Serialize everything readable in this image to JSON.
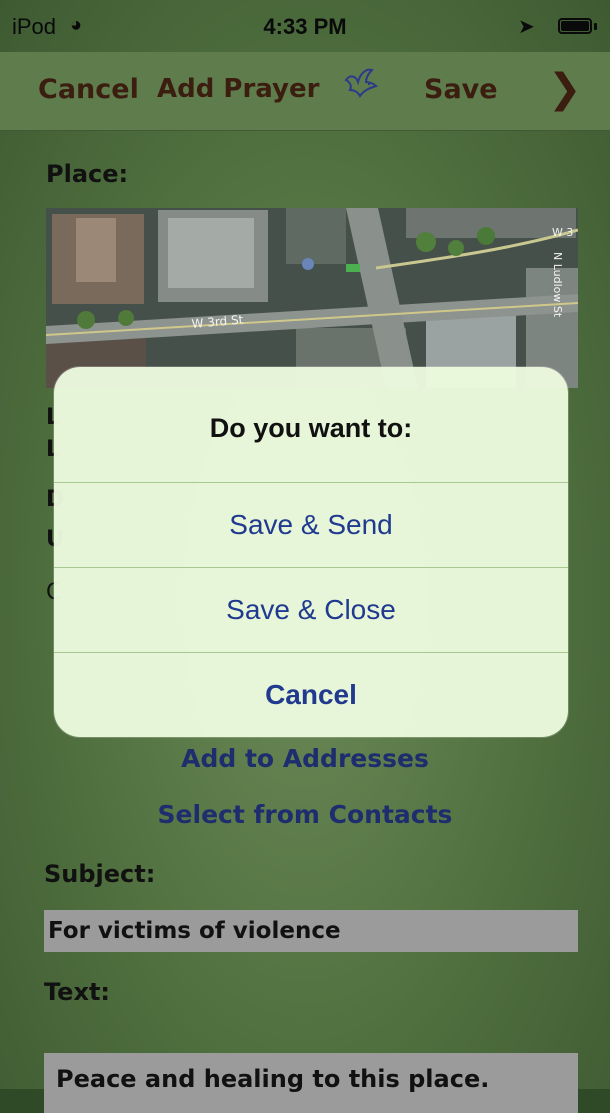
{
  "status_bar": {
    "carrier": "iPod",
    "time": "4:33 PM"
  },
  "nav_bar": {
    "cancel_label": "Cancel",
    "title": "Add Prayer",
    "save_label": "Save",
    "icons": [
      "dove-icon",
      "chevron-right-icon"
    ]
  },
  "form": {
    "place_label": "Place:",
    "map_street_labels": [
      "W 3rd St",
      "N Ludlow St",
      "W 3"
    ],
    "add_to_addresses": "Add to Addresses",
    "select_from_contacts": "Select from Contacts",
    "subject_label": "Subject:",
    "subject_value": "For victims of violence",
    "text_label": "Text:",
    "text_value": "Peace and healing to this place."
  },
  "alert": {
    "title": "Do you want to:",
    "actions": [
      "Save & Send",
      "Save & Close",
      "Cancel"
    ]
  },
  "colors": {
    "nav_text": "#3b1e10",
    "link_text": "#1d2d6e",
    "alert_action": "#1f3a8f",
    "alert_background": "#ecfade",
    "background": "#50703f"
  }
}
